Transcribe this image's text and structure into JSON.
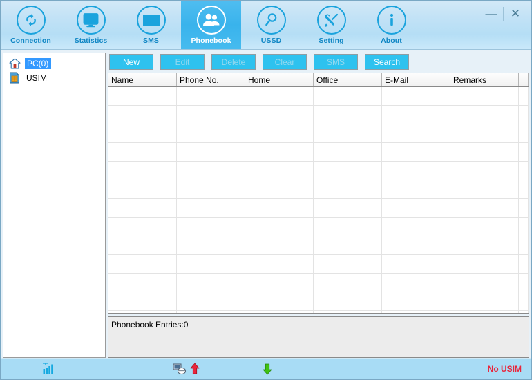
{
  "window": {
    "minimize_label": "—",
    "close_label": "✕"
  },
  "toolbar": {
    "tabs": [
      {
        "label": "Connection",
        "icon": "refresh-sync-icon",
        "active": false
      },
      {
        "label": "Statistics",
        "icon": "bar-chart-monitor-icon",
        "active": false
      },
      {
        "label": "SMS",
        "icon": "envelope-icon",
        "active": false
      },
      {
        "label": "Phonebook",
        "icon": "contacts-people-icon",
        "active": true
      },
      {
        "label": "USSD",
        "icon": "magnifier-icon",
        "active": false
      },
      {
        "label": "Setting",
        "icon": "wrench-screwdriver-icon",
        "active": false
      },
      {
        "label": "About",
        "icon": "info-icon",
        "active": false
      }
    ]
  },
  "sidebar": {
    "items": [
      {
        "label": "PC(0)",
        "icon": "home-icon",
        "selected": true
      },
      {
        "label": "USIM",
        "icon": "sim-card-icon",
        "selected": false
      }
    ]
  },
  "actions": {
    "buttons": [
      {
        "label": "New",
        "enabled": true
      },
      {
        "label": "Edit",
        "enabled": false
      },
      {
        "label": "Delete",
        "enabled": false
      },
      {
        "label": "Clear",
        "enabled": false
      },
      {
        "label": "SMS",
        "enabled": false
      },
      {
        "label": "Search",
        "enabled": true
      }
    ]
  },
  "table": {
    "columns": [
      "Name",
      "Phone No.",
      "Home",
      "Office",
      "E-Mail",
      "Remarks",
      ""
    ],
    "rows": []
  },
  "status_panel": {
    "text": "Phonebook Entries:0"
  },
  "statusbar": {
    "signal_icon": "signal-bars-icon",
    "network_icon": "network-connection-icon",
    "upload_icon": "upload-arrow-icon",
    "download_icon": "download-arrow-icon",
    "usim_status": "No USIM"
  },
  "colors": {
    "accent": "#1ba3dd",
    "active_tab": "#3cb4ec",
    "button": "#2ec2ef",
    "selection": "#3399ff",
    "error": "#e8253b",
    "statusbar": "#a8dcf5"
  }
}
